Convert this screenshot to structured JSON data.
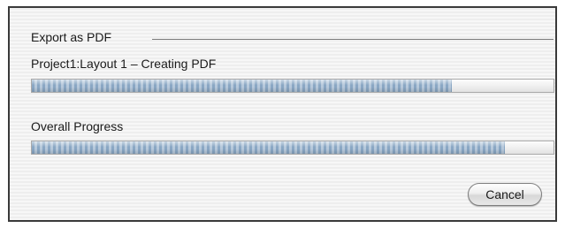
{
  "dialog": {
    "group_title": "Export as PDF",
    "task": {
      "label": "Project1:Layout 1 – Creating PDF",
      "progress": 0.805
    },
    "overall": {
      "label": "Overall Progress",
      "progress": 0.907
    },
    "cancel_label": "Cancel"
  },
  "colors": {
    "progress_fill": "#8fa9c3",
    "track_border": "#a9a9a9",
    "dialog_border": "#3a3a3a"
  }
}
